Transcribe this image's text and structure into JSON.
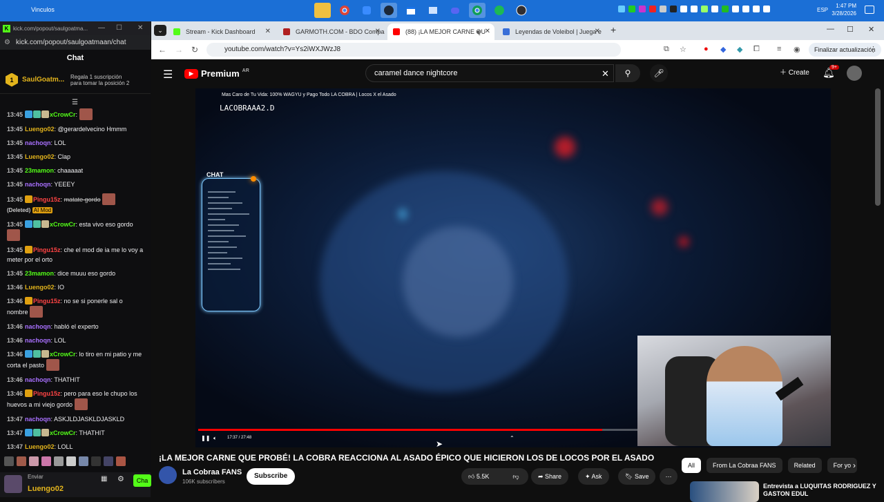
{
  "taskbar": {
    "folder_label": "Vinculos",
    "lang": "ESP",
    "time": "1:47 PM",
    "date": "3/28/2026"
  },
  "chat_window": {
    "tab_url": "kick.com/popout/saulgoatma...",
    "url": "kick.com/popout/saulgoatmaan/chat",
    "header": "Chat",
    "pinned": {
      "badge": "1",
      "name": "SaulGoatm...",
      "gift_text": "Regala 1 suscripción para tomar la posición 2"
    },
    "messages": [
      {
        "time": "13:45",
        "user": "xCrowCr",
        "color": "#53fc18",
        "badges": true,
        "text": ":",
        "emote": true
      },
      {
        "time": "13:45",
        "user": "Luengo02",
        "color": "#e3b41c",
        "text": ": @gerardelvecino Hmmm"
      },
      {
        "time": "13:45",
        "user": "nachoqn",
        "color": "#a970ff",
        "text": ": LOL"
      },
      {
        "time": "13:45",
        "user": "Luengo02",
        "color": "#e3b41c",
        "text": ": Clap"
      },
      {
        "time": "13:45",
        "user": "23mamon",
        "color": "#53fc18",
        "text": ": chaaaaat"
      },
      {
        "time": "13:45",
        "user": "nachoqn",
        "color": "#a970ff",
        "text": ": YEEEY"
      },
      {
        "time": "13:45",
        "user": "Pingu15z",
        "color": "#ff4444",
        "crown": true,
        "deleted_text": "matate gordo",
        "deleted_label": "(Deleted)",
        "aimod": "AI Mod"
      },
      {
        "time": "13:45",
        "user": "xCrowCr",
        "color": "#53fc18",
        "badges": true,
        "text": ": esta vivo eso gordo",
        "emote": true
      },
      {
        "time": "13:45",
        "user": "Pingu15z",
        "color": "#ff4444",
        "crown": true,
        "text": ": che el mod de ia me lo voy a meter por el orto"
      },
      {
        "time": "13:45",
        "user": "23mamon",
        "color": "#53fc18",
        "text": ": dice muuu eso gordo"
      },
      {
        "time": "13:46",
        "user": "Luengo02",
        "color": "#e3b41c",
        "text": ": IO"
      },
      {
        "time": "13:46",
        "user": "Pingu15z",
        "color": "#ff4444",
        "crown": true,
        "text": ": no se si ponerle sal o nombre",
        "emote": true
      },
      {
        "time": "13:46",
        "user": "nachoqn",
        "color": "#a970ff",
        "text": ": habló el experto"
      },
      {
        "time": "13:46",
        "user": "nachoqn",
        "color": "#a970ff",
        "text": ": LOL"
      },
      {
        "time": "13:46",
        "user": "xCrowCr",
        "color": "#53fc18",
        "badges": true,
        "text": ": lo tiro en mi patio y me corta el pasto",
        "emote": true
      },
      {
        "time": "13:46",
        "user": "nachoqn",
        "color": "#a970ff",
        "text": ": THATHIT"
      },
      {
        "time": "13:46",
        "user": "Pingu15z",
        "color": "#ff4444",
        "crown": true,
        "text": ": pero para eso le chupo los huevos a mi viejo gordo",
        "emote": true
      },
      {
        "time": "13:47",
        "user": "nachoqn",
        "color": "#a970ff",
        "text": ": ASKJLDJASKLDJASKLD"
      },
      {
        "time": "13:47",
        "user": "xCrowCr",
        "color": "#53fc18",
        "badges": true,
        "text": ": THATHIT"
      },
      {
        "time": "13:47",
        "user": "Luengo02",
        "color": "#e3b41c",
        "text": ": LOLL"
      }
    ],
    "send_label": "Enviar",
    "me_name": "Luengo02",
    "chat_button": "Cha"
  },
  "browser": {
    "tabs": [
      {
        "title": "Stream - Kick Dashboard",
        "fav_color": "#53fc18"
      },
      {
        "title": "GARMOTH.COM - BDO Compa",
        "fav_color": "#b02020"
      },
      {
        "title": "(88) ¡LA MEJOR CARNE QU",
        "fav_color": "#ff0000",
        "active": true
      },
      {
        "title": "Leyendas de Voleibol | Juega e",
        "fav_color": "#3a6fd8"
      }
    ],
    "url": "youtube.com/watch?v=Ys2iWXJWzJ8",
    "update_label": "Finalizar actualización"
  },
  "youtube": {
    "logo_text": "Premium",
    "logo_region": "AR",
    "search_value": "caramel dance nightcore",
    "create_label": "Create",
    "notif_count": "9+",
    "overlay_title": "Mas Caro de Tu Vida: 100% WAGYU y Pago Todo LA COBRA | Locos X el Asado",
    "overlay_handle": "LACOBRAAA2.D",
    "overlay_chat_tag": "CHAT",
    "time_display": "17:37 / 27:48",
    "progress": 0.92,
    "video_title": "¡LA MEJOR CARNE QUE PROBÉ! LA COBRA REACCIONA AL ASADO ÉPICO QUE HICIERON LOS DE LOCOS POR EL ASADO",
    "channel_name": "La Cobraa FANS",
    "channel_subs": "106K subscribers",
    "subscribe_label": "Subscribe",
    "likes": "5.5K",
    "share_label": "Share",
    "ask_label": "Ask",
    "save_label": "Save",
    "filters": [
      "All",
      "From La Cobraa FANS",
      "Related",
      "For yo"
    ],
    "rec_title": "Entrevista a LUQUITAS RODRIGUEZ Y GASTON EDUL"
  }
}
